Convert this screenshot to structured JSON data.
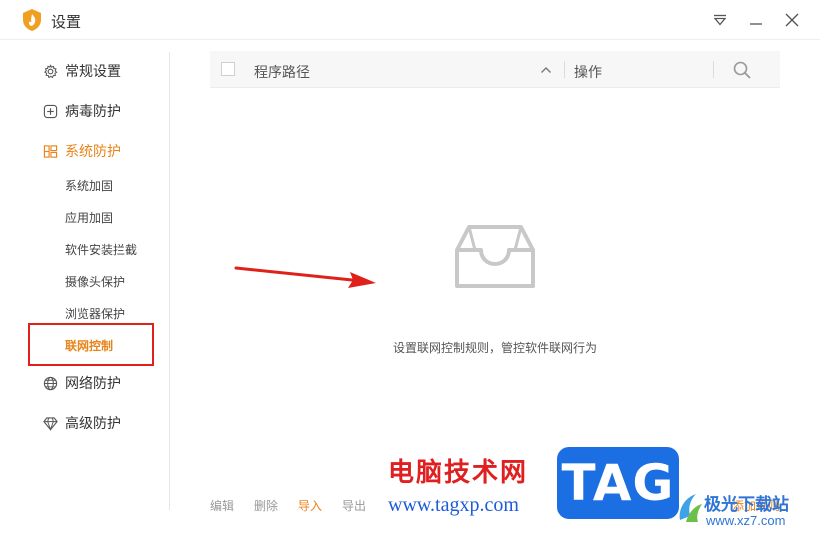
{
  "window": {
    "title": "设置"
  },
  "sidebar": {
    "items": [
      {
        "label": "常规设置",
        "icon": "gear-icon"
      },
      {
        "label": "病毒防护",
        "icon": "plus-square-icon"
      },
      {
        "label": "系统防护",
        "icon": "system-protect-icon",
        "active": true
      },
      {
        "label": "网络防护",
        "icon": "globe-icon"
      },
      {
        "label": "高级防护",
        "icon": "diamond-icon"
      }
    ],
    "sub_items": [
      {
        "label": "系统加固"
      },
      {
        "label": "应用加固"
      },
      {
        "label": "软件安装拦截"
      },
      {
        "label": "摄像头保护"
      },
      {
        "label": "浏览器保护"
      },
      {
        "label": "联网控制",
        "active": true
      }
    ]
  },
  "table": {
    "column_path": "程序路径",
    "column_action": "操作"
  },
  "empty_state": {
    "message": "设置联网控制规则，管控软件联网行为"
  },
  "footer": {
    "edit": "编辑",
    "delete": "删除",
    "import": "导入",
    "export": "导出",
    "add": "添加规则"
  },
  "watermark": {
    "cn_text": "电脑技术网",
    "url": "www.tagxp.com",
    "tag": "TAG",
    "site_name": "极光下载站",
    "site_url": "www.xz7.com"
  },
  "colors": {
    "accent": "#e8841a",
    "highlight_border": "#e0201b",
    "annotation_arrow": "#e0201b",
    "watermark_blue": "#1b6fe3"
  }
}
